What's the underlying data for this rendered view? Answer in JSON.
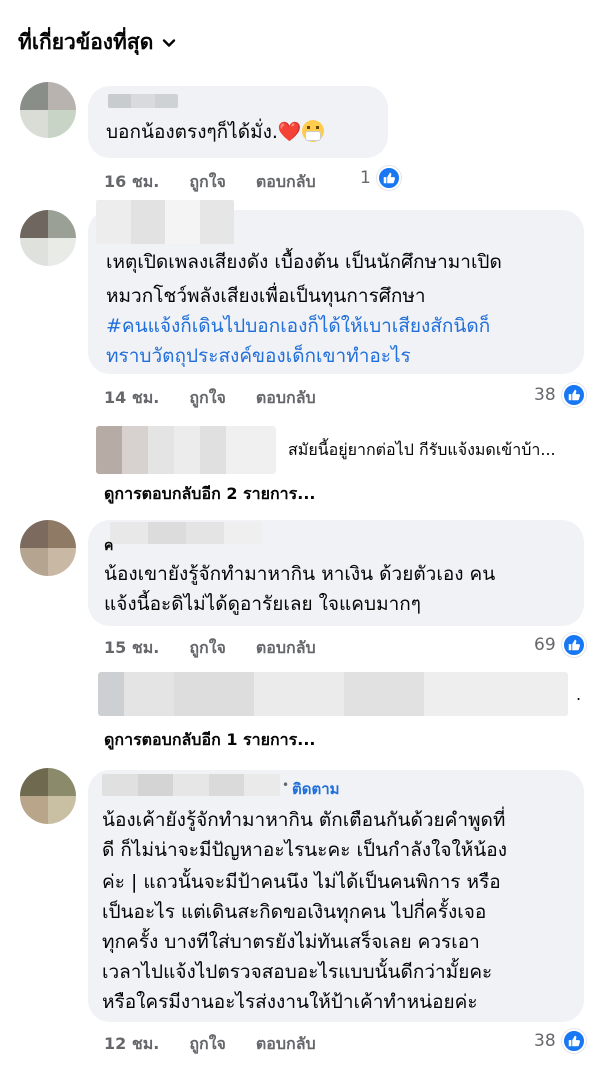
{
  "sort": {
    "label": "ที่เกี่ยวข้องที่สุด",
    "icon": "chevron-down-icon"
  },
  "actions": {
    "like": "ถูกใจ",
    "reply": "ตอบกลับ"
  },
  "colors": {
    "like_blue": "#1877f2",
    "link_blue": "#216fdb",
    "bubble_bg": "#f0f2f5",
    "meta_gray": "#65676b"
  },
  "comments": [
    {
      "lines": [
        "บอกน้องตรงๆก็ได้มั่ง."
      ],
      "emoji": [
        "❤️",
        "😷"
      ],
      "time": "16 ชม.",
      "reaction_count": "1"
    },
    {
      "lines": [
        "เหตุเปิดเพลงเสียงดัง เบื้องต้น เป็นนักศึกษามาเปิด",
        "หมวกโชว์พลังเสียงเพื่อเป็นทุนการศึกษา"
      ],
      "hashtag_lines": [
        "#คนแจ้งก็เดินไปบอกเองก็ได้ให้เบาเสียงสักนิดก็",
        "ทราบวัตถุประสงค์ของเด็กเขาทำอะไร"
      ],
      "time": "14 ชม.",
      "reaction_count": "38",
      "reply_preview": "สมัยนี้อยู่ยากต่อไป กีรับแจ้งมดเข้าบ้า...",
      "more_replies": "ดูการตอบกลับอีก 2 รายการ..."
    },
    {
      "name_fragment": "ค",
      "lines": [
        "น้องเขายังรู้จักทำมาหากิน หาเงิน ด้วยตัวเอง คน",
        "แจ้งนี้อะดิไม่ได้ดูอารัยเลย ใจแคบมากๆ"
      ],
      "time": "15 ชม.",
      "reaction_count": "69",
      "reply_preview": ".",
      "more_replies": "ดูการตอบกลับอีก 1 รายการ..."
    },
    {
      "follow": "ติดตาม",
      "lines": [
        "น้องเค้ายังรู้จักทำมาหากิน ตักเตือนกันด้วยคำพูดที่",
        "ดี ก็ไม่น่าจะมีปัญหาอะไรนะคะ เป็นกำลังใจให้น้อง",
        "ค่ะ | แถวนั้นจะมีป้าคนนึง ไม่ได้เป็นคนพิการ หรือ",
        "เป็นอะไร แต่เดินสะกิดขอเงินทุกคน ไปกี่ครั้งเจอ",
        "ทุกครั้ง บางทีใส่บาตรยังไม่ทันเสร็จเลย ควรเอา",
        "เวลาไปแจ้งไปตรวจสอบอะไรแบบนั้นดีกว่ามั้ยคะ",
        "หรือใครมีงานอะไรส่งงานให้ป้าเค้าทำหน่อยค่ะ"
      ],
      "time": "12 ชม.",
      "reaction_count": "38"
    }
  ]
}
